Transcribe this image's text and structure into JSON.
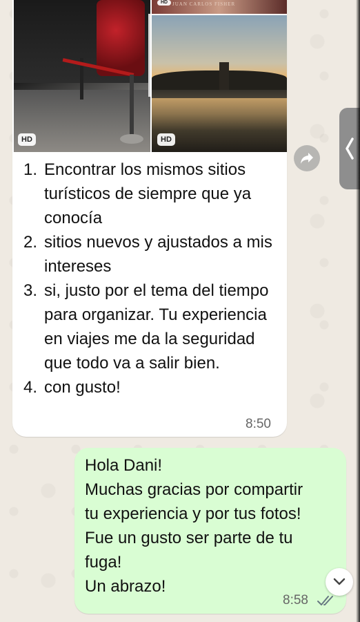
{
  "chat": {
    "incoming": {
      "photos": {
        "left_badge": "HD",
        "right_badge": "HD",
        "top_badge": "HD",
        "top_caption": "JUAN CARLOS FISHER"
      },
      "items": [
        {
          "num": "1.",
          "text": "Encontrar los mismos sitios turísticos de siempre que ya conocía"
        },
        {
          "num": "2.",
          "text": "sitios nuevos y ajustados a mis intereses"
        },
        {
          "num": "3.",
          "text": "si, justo por el tema del tiempo para organizar. Tu experiencia en viajes me da la seguridad que todo va a salir bien."
        },
        {
          "num": "4.",
          "text": "con gusto!"
        }
      ],
      "time": "8:50"
    },
    "outgoing": {
      "lines": [
        "Hola Dani!",
        "Muchas gracias por compartir",
        "tu experiencia y por tus fotos!",
        "Fue un gusto ser parte de tu",
        "fuga!",
        "Un abrazo!"
      ],
      "time": "8:58",
      "status_icon": "double-check-icon"
    },
    "icons": {
      "forward": "forward-icon",
      "side": "chevron-left-icon",
      "scroll": "chevron-down-icon"
    },
    "colors": {
      "background": "#efeae2",
      "incoming_bubble": "#ffffff",
      "outgoing_bubble": "#d9fdd3",
      "timestamp": "#666666"
    }
  }
}
